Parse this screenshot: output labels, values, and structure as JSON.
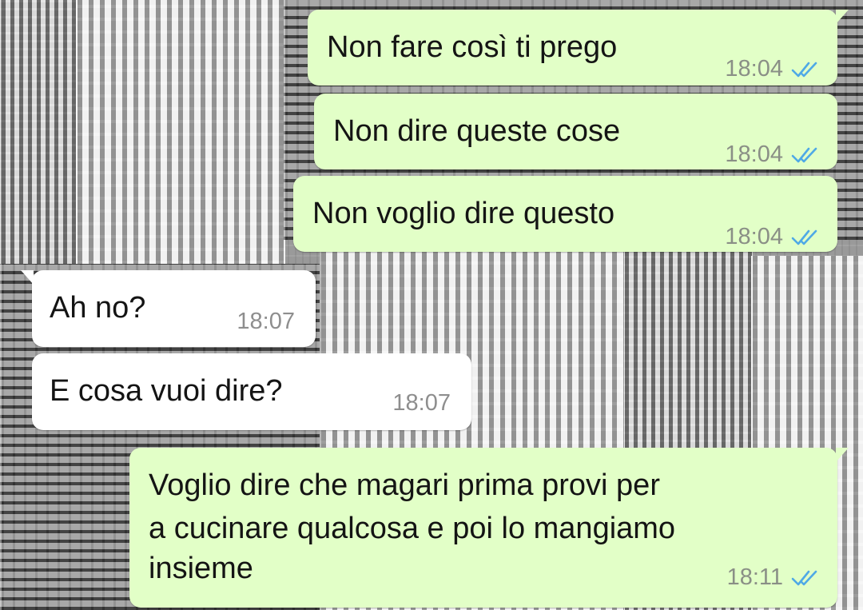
{
  "chat": {
    "messages": [
      {
        "direction": "outgoing",
        "text": "Non fare così ti prego",
        "time": "18:04",
        "status": "read"
      },
      {
        "direction": "outgoing",
        "text": "Non dire queste cose",
        "time": "18:04",
        "status": "read"
      },
      {
        "direction": "outgoing",
        "text": "Non voglio dire questo",
        "time": "18:04",
        "status": "read"
      },
      {
        "direction": "incoming",
        "text": "Ah no?",
        "time": "18:07"
      },
      {
        "direction": "incoming",
        "text": "E cosa vuoi dire?",
        "time": "18:07"
      },
      {
        "direction": "outgoing",
        "text_lines": [
          "Voglio dire che magari prima provi per",
          "a cucinare qualcosa e poi lo mangiamo",
          "insieme"
        ],
        "time": "18:11",
        "status": "read"
      }
    ]
  },
  "colors": {
    "outgoing_bubble": "#e2ffc7",
    "incoming_bubble": "#ffffff",
    "read_tick": "#4fa9e6",
    "wallpaper": "grayscale-city"
  },
  "icons": {
    "read_receipt": "double-check-icon"
  }
}
